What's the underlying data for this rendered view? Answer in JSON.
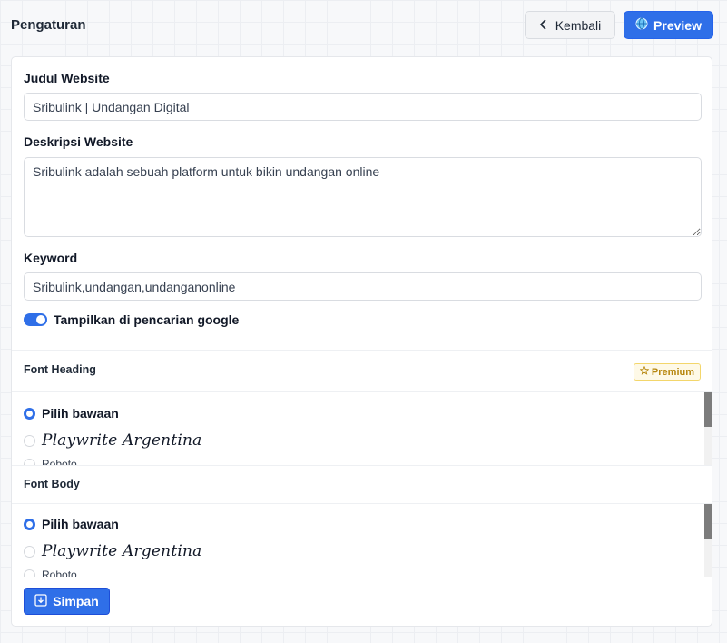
{
  "header": {
    "title": "Pengaturan",
    "back_label": "Kembali",
    "preview_label": "Preview"
  },
  "form": {
    "title_label": "Judul Website",
    "title_value": "Sribulink | Undangan Digital",
    "description_label": "Deskripsi Website",
    "description_value": "Sribulink adalah sebuah platform untuk bikin undangan online",
    "keyword_label": "Keyword",
    "keyword_value": "Sribulink,undangan,undanganonline",
    "google_toggle_label": "Tampilkan di pencarian google",
    "google_toggle_on": true
  },
  "font_heading": {
    "title": "Font Heading",
    "badge": "Premium",
    "options": [
      "Pilih bawaan",
      "Playwrite Argentina",
      "Roboto"
    ],
    "selected": "Pilih bawaan"
  },
  "font_body": {
    "title": "Font Body",
    "options": [
      "Pilih bawaan",
      "Playwrite Argentina",
      "Roboto"
    ],
    "selected": "Pilih bawaan"
  },
  "save_label": "Simpan",
  "icons": {
    "back": "chevron-left-icon",
    "preview": "globe-icon",
    "premium": "star-icon",
    "save": "save-download-icon"
  },
  "colors": {
    "primary": "#2f6fe8",
    "premium_bg": "#fef9e7",
    "premium_text": "#b7870f"
  }
}
